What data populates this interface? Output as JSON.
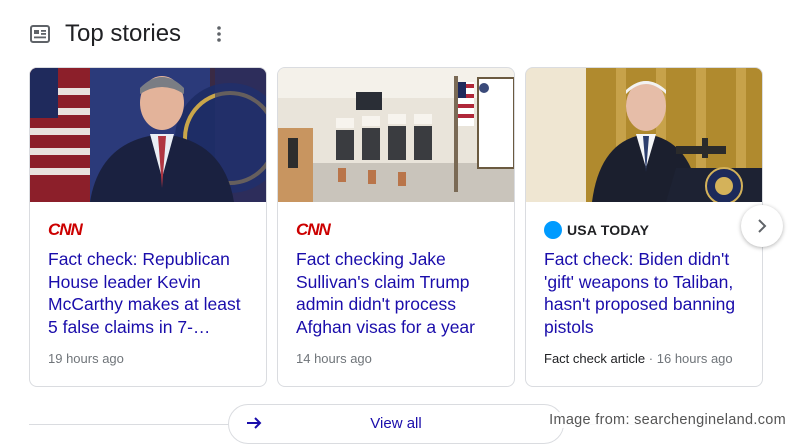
{
  "header": {
    "title": "Top stories",
    "icon": "news-icon",
    "more_icon": "more-vert-icon"
  },
  "cards": [
    {
      "source": "CNN",
      "headline": "Fact check: Republican House leader Kevin McCarthy makes at least 5 false claims in 7-…",
      "time": "19 hours ago"
    },
    {
      "source": "CNN",
      "headline": "Fact checking Jake Sullivan's claim Trump admin didn't process Afghan visas for a year",
      "time": "14 hours ago"
    },
    {
      "source": "USA TODAY",
      "headline": "Fact check: Biden didn't 'gift' weapons to Taliban, hasn't proposed banning pistols",
      "label": "Fact check article",
      "separator": "·",
      "time": "16 hours ago"
    }
  ],
  "view_all": {
    "label": "View all"
  },
  "credit": "Image from: searchengineland.com",
  "colors": {
    "link": "#1a0dab",
    "cnn": "#cc0000",
    "usa_today": "#009bff",
    "meta": "#70757a"
  }
}
